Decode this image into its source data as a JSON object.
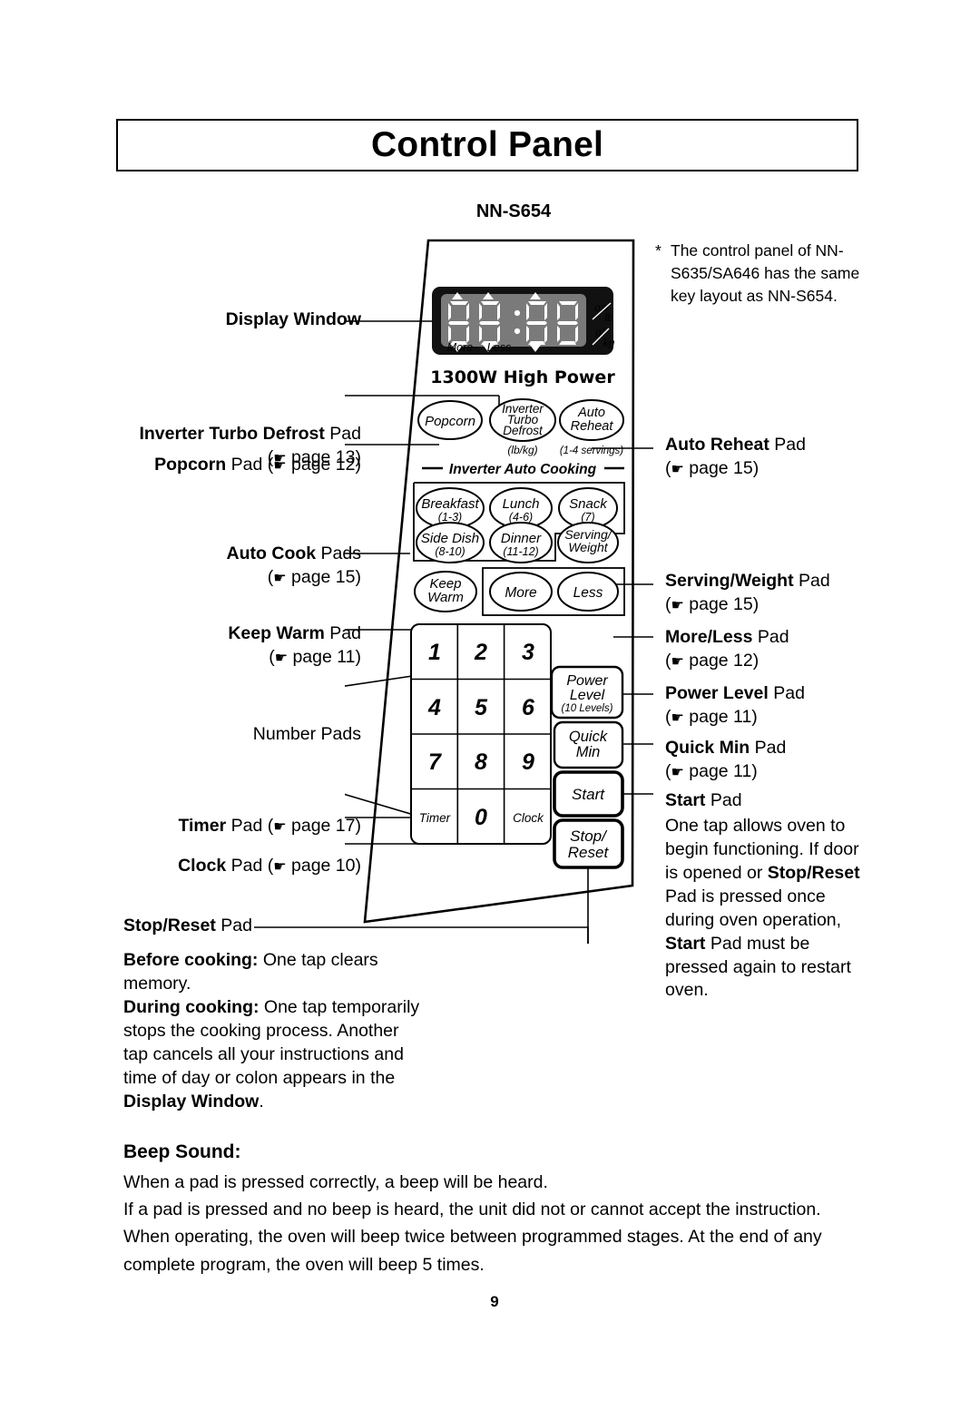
{
  "title": "Control Panel",
  "model_label": "NN-S654",
  "footnote": {
    "marker": "*",
    "text": "The control panel of NN-S635/SA646 has the same key layout as NN-S654."
  },
  "panel": {
    "display": {
      "digits": "88:88",
      "unit_top": "oz/lb",
      "unit_bottom": "g/kg",
      "indicator_more": "More",
      "indicator_less": "Less"
    },
    "power_rating": "1300W High Power",
    "section_title": "Inverter Auto Cooking",
    "buttons": {
      "popcorn": "Popcorn",
      "inverter_turbo_defrost": "Inverter Turbo Defrost",
      "inverter_turbo_defrost_sub": "(lb/kg)",
      "auto_reheat": "Auto Reheat",
      "auto_reheat_sub": "(1-4 servings)",
      "breakfast": "Breakfast",
      "breakfast_sub": "(1-3)",
      "lunch": "Lunch",
      "lunch_sub": "(4-6)",
      "snack": "Snack",
      "snack_sub": "(7)",
      "side_dish": "Side Dish",
      "side_dish_sub": "(8-10)",
      "dinner": "Dinner",
      "dinner_sub": "(11-12)",
      "serving_weight": "Serving/ Weight",
      "keep_warm": "Keep Warm",
      "more": "More",
      "less": "Less",
      "power_level": "Power Level",
      "power_level_sub": "(10 Levels)",
      "quick_min": "Quick Min",
      "start": "Start",
      "stop_reset": "Stop/ Reset",
      "timer": "Timer",
      "clock": "Clock",
      "numbers": [
        "1",
        "2",
        "3",
        "4",
        "5",
        "6",
        "7",
        "8",
        "9",
        "0"
      ]
    }
  },
  "callouts_left": {
    "display_window": {
      "bold": "Display Window",
      "rest": ""
    },
    "inverter_turbo_defrost": {
      "bold": "Inverter Turbo Defrost",
      "rest": " Pad",
      "page": "( page 13)"
    },
    "popcorn": {
      "bold": "Popcorn",
      "rest": " Pad ",
      "page": "( page 12)"
    },
    "auto_cook": {
      "bold": "Auto Cook",
      "rest": " Pads",
      "page": "( page 15)"
    },
    "keep_warm": {
      "bold": "Keep Warm",
      "rest": " Pad",
      "page": "( page 11)"
    },
    "number_pads": {
      "bold": "",
      "rest": "Number Pads"
    },
    "timer": {
      "bold": "Timer",
      "rest": " Pad ",
      "page": "( page 17)"
    },
    "clock": {
      "bold": "Clock",
      "rest": " Pad ",
      "page": "( page 10)"
    },
    "stop_reset": {
      "bold": "Stop/Reset",
      "rest": " Pad"
    }
  },
  "callouts_right": {
    "auto_reheat": {
      "bold": "Auto Reheat",
      "rest": " Pad",
      "page": "( page 15)"
    },
    "serving_weight": {
      "bold": "Serving/Weight",
      "rest": " Pad",
      "page": "( page 15)"
    },
    "more_less": {
      "bold": "More/Less",
      "rest": " Pad",
      "page": "( page 12)"
    },
    "power_level": {
      "bold": "Power Level",
      "rest": " Pad",
      "page": "( page 11)"
    },
    "quick_min": {
      "bold": "Quick Min",
      "rest": " Pad",
      "page": "( page 11)"
    },
    "start": {
      "bold": "Start",
      "rest": " Pad"
    }
  },
  "start_description": {
    "line1": "One tap allows oven to begin functioning. If door is opened or ",
    "bold1": "Stop/Reset",
    "line2": " Pad is pressed once during oven operation, ",
    "bold2": "Start",
    "line3": " Pad must be pressed again to restart oven."
  },
  "stopreset_description": {
    "bold1": "Before cooking:",
    "text1": " One tap clears memory.",
    "bold2": "During cooking:",
    "text2": " One tap temporarily stops the cooking process. Another tap cancels all your instructions and time of day or colon appears in the ",
    "bold3": "Display Window",
    "text3": "."
  },
  "beep": {
    "heading": "Beep Sound:",
    "line1": "When a pad is pressed correctly, a beep will be heard.",
    "line2": "If a pad is pressed and no beep is heard, the unit did not or cannot accept the instruction.",
    "line3": "When operating, the oven will beep twice between programmed stages. At the end of any complete program, the oven will beep 5 times."
  },
  "page_number": "9",
  "icons": {
    "hand_pointer": "☛"
  }
}
